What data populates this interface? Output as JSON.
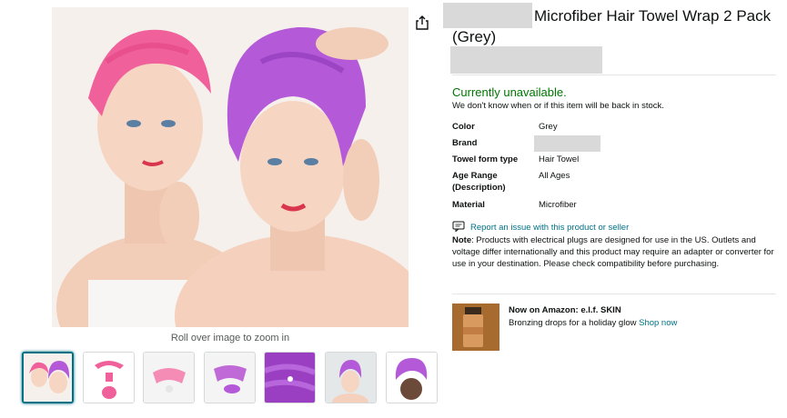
{
  "title": "Microfiber Hair Towel Wrap 2 Pack (Grey)",
  "share": {
    "icon": "share-icon"
  },
  "zoom_hint": "Roll over image to zoom in",
  "availability": {
    "status": "Currently unavailable.",
    "note": "We don't know when or if this item will be back in stock."
  },
  "specs": [
    {
      "label": "Color",
      "value": "Grey"
    },
    {
      "label": "Brand",
      "value": ""
    },
    {
      "label": "Towel form type",
      "value": "Hair Towel"
    },
    {
      "label": "Age Range (Description)",
      "value": "All Ages"
    },
    {
      "label": "Material",
      "value": "Microfiber"
    }
  ],
  "report": {
    "icon": "report-icon",
    "label": "Report an issue with this product or seller"
  },
  "note": {
    "label": "Note",
    "text": ": Products with electrical plugs are designed for use in the US. Outlets and voltage differ internationally and this product may require an adapter or converter for use in your destination. Please check compatibility before purchasing."
  },
  "ad": {
    "title": "Now on Amazon: e.l.f. SKIN",
    "text": "Bronzing drops for a holiday glow",
    "link": "Shop now"
  },
  "colors": {
    "accent_link": "#007185",
    "available_green": "#007600",
    "pink_towel": "#f0609a",
    "purple_towel": "#b45ad8"
  }
}
